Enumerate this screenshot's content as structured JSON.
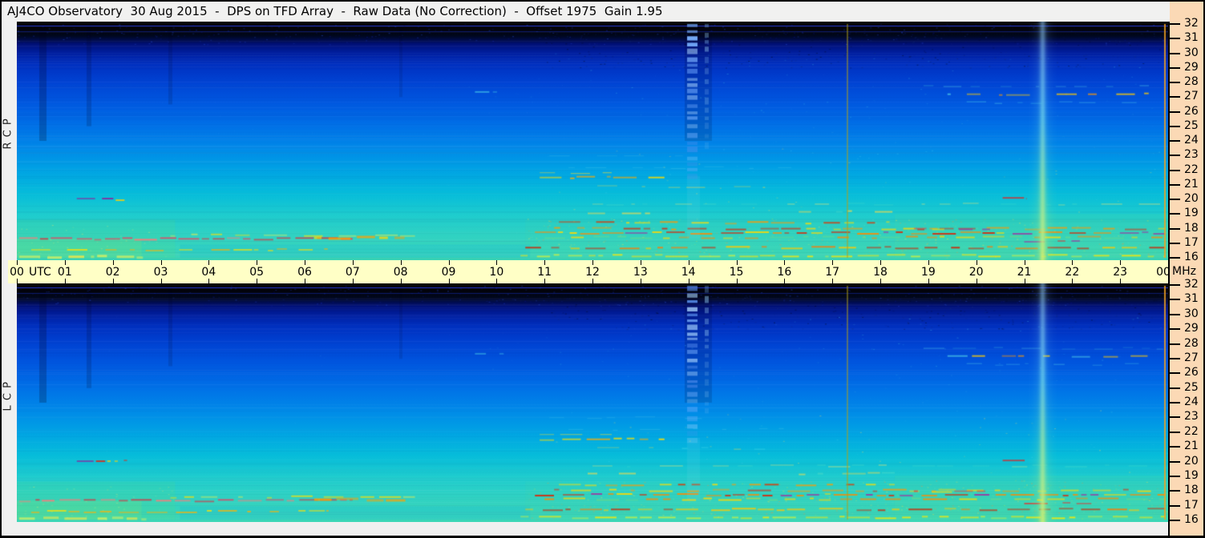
{
  "colors": {
    "titlebar_bg": "#f1f1f0",
    "time_band_bg": "#ffffc6",
    "freq_band_bg": "#fbd9b5",
    "gutter_bg": "#f0f0f0",
    "border": "#000000"
  },
  "chart_data": {
    "type": "heatmap",
    "title": "AJ4CO Observatory  30 Aug 2015  -  DPS on TFD Array  -  Raw Data (No Correction)  -  Offset 1975  Gain 1.95",
    "panels": [
      {
        "id": "rcp",
        "label": "R C P",
        "seed": 7
      },
      {
        "id": "lcp",
        "label": "L C P",
        "seed": 13
      }
    ],
    "x_axis": {
      "unit": "UTC",
      "right_unit": "MHz",
      "range_hours": [
        0,
        24
      ],
      "tick_labels": [
        "00",
        "01",
        "02",
        "03",
        "04",
        "05",
        "06",
        "07",
        "08",
        "09",
        "10",
        "11",
        "12",
        "13",
        "14",
        "15",
        "16",
        "17",
        "18",
        "19",
        "20",
        "21",
        "22",
        "23",
        "00"
      ]
    },
    "y_axis": {
      "unit": "MHz",
      "range_mhz": [
        16,
        32
      ],
      "ticks": [
        32,
        31,
        30,
        29,
        28,
        27,
        26,
        25,
        24,
        23,
        22,
        21,
        20,
        19,
        18,
        17,
        16
      ]
    },
    "gradient_stops": [
      [
        0.0,
        "#050505"
      ],
      [
        0.03,
        "#030308"
      ],
      [
        0.06,
        "#00071e"
      ],
      [
        0.095,
        "#001078"
      ],
      [
        0.13,
        "#001e9e"
      ],
      [
        0.18,
        "#0030c0"
      ],
      [
        0.25,
        "#0042d2"
      ],
      [
        0.33,
        "#0055de"
      ],
      [
        0.42,
        "#006ce6"
      ],
      [
        0.52,
        "#0086e8"
      ],
      [
        0.62,
        "#00a2e4"
      ],
      [
        0.72,
        "#06bcda"
      ],
      [
        0.81,
        "#1eccce"
      ],
      [
        0.9,
        "#30d2c2"
      ],
      [
        1.0,
        "#3cd6b6"
      ]
    ],
    "hlines": [
      {
        "y": 0.018,
        "c": "#2840ff",
        "a": 0.8
      },
      {
        "y": 0.041,
        "c": "#1830cc",
        "a": 0.5
      },
      {
        "y": 0.275,
        "c": "#ffffff",
        "a": 0.045
      },
      {
        "y": 0.52,
        "c": "#ffffff",
        "a": 0.06
      }
    ],
    "overlays": [
      {
        "t0": 0,
        "t1": 3.3,
        "f0": 16,
        "f1": 18.6,
        "c": "#58e07c",
        "a": 0.15
      },
      {
        "t0": 0,
        "t1": 2.6,
        "f0": 16,
        "f1": 17.3,
        "c": "#8ce86a",
        "a": 0.18
      },
      {
        "t0": 3.4,
        "t1": 10.7,
        "f0": 16,
        "f1": 16.9,
        "c": "#00a8e8",
        "a": 0.15
      },
      {
        "t0": 18.3,
        "t1": 24,
        "f0": 16,
        "f1": 19,
        "c": "#70e070",
        "a": 0.08
      },
      {
        "t0": 10.6,
        "t1": 24,
        "f0": 16,
        "f1": 18.6,
        "c": "#50dca0",
        "a": 0.1
      }
    ],
    "dark_columns": [
      {
        "t": 0.55,
        "w": 9,
        "f0": 24,
        "f1": 32,
        "c": "#000018",
        "a": 0.22
      },
      {
        "t": 1.5,
        "w": 6,
        "f0": 25,
        "f1": 32,
        "c": "#000018",
        "a": 0.16
      },
      {
        "t": 3.2,
        "w": 5,
        "f0": 26.5,
        "f1": 32,
        "c": "#000018",
        "a": 0.13
      },
      {
        "t": 8.0,
        "w": 4,
        "f0": 27,
        "f1": 32,
        "c": "#000010",
        "a": 0.1
      },
      {
        "t": 14.2,
        "w": 34,
        "f0": 24,
        "f1": 32,
        "c": "#000020",
        "a": 0.15
      }
    ],
    "noise": [
      {
        "t0": 0,
        "t1": 24,
        "f0": 30.6,
        "f1": 32,
        "colors": [
          "#1830c0",
          "#2850e0",
          "#081090"
        ],
        "d": 0.9,
        "a": 0.5,
        "s": 2
      },
      {
        "t0": 11,
        "t1": 24,
        "f0": 29,
        "f1": 31.5,
        "colors": [
          "#000818",
          "#122a78"
        ],
        "d": 0.8,
        "a": 0.5,
        "s": 2
      },
      {
        "t0": 10.6,
        "t1": 24,
        "f0": 16,
        "f1": 18.7,
        "colors": [
          "#ffe040",
          "#a0e060",
          "#ff9030",
          "#58dcc0"
        ],
        "d": 0.9,
        "a": 0.45,
        "s": 2
      },
      {
        "t0": 0,
        "t1": 3.3,
        "f0": 16,
        "f1": 18.3,
        "colors": [
          "#c0f080",
          "#ffe860"
        ],
        "d": 0.5,
        "a": 0.4,
        "s": 2
      },
      {
        "t0": 11,
        "t1": 24,
        "f0": 19,
        "f1": 23.5,
        "colors": [
          "#40c8e8",
          "#ffe060"
        ],
        "d": 0.1,
        "a": 0.4,
        "s": 2
      },
      {
        "t0": 11,
        "t1": 24,
        "f0": 25.5,
        "f1": 30,
        "colors": [
          "#2090e0",
          "#40c8e8"
        ],
        "d": 0.1,
        "a": 0.35,
        "s": 2
      },
      {
        "t0": 14,
        "t1": 24,
        "f0": 23,
        "f1": 26,
        "colors": [
          "#2f9fe0"
        ],
        "d": 0.08,
        "a": 0.3,
        "s": 2
      },
      {
        "t0": 5,
        "t1": 11,
        "f0": 26,
        "f1": 28.5,
        "colors": [
          "#30a0e0"
        ],
        "d": 0.03,
        "a": 0.3,
        "s": 2
      },
      {
        "t0": 0,
        "t1": 24,
        "f0": 16,
        "f1": 32,
        "colors": [
          "#ffffff"
        ],
        "d": 0.05,
        "a": 0.05,
        "s": 1
      }
    ],
    "streaks": [
      {
        "t0": 1.25,
        "t1": 2.3,
        "f": 20.05,
        "h": 2,
        "colors": [
          "#d03020",
          "#8030a0",
          "#ffd000"
        ],
        "d": 0.85,
        "a": 0.95
      },
      {
        "t0": 0.05,
        "t1": 7.0,
        "f": 17.35,
        "h": 2,
        "colors": [
          "#e84060",
          "#ff7878",
          "#d83040"
        ],
        "d": 0.9,
        "a": 0.9
      },
      {
        "t0": 0.3,
        "t1": 6.5,
        "f": 16.6,
        "h": 2,
        "colors": [
          "#ffe000",
          "#ffb000"
        ],
        "d": 0.5,
        "a": 0.8
      },
      {
        "t0": 3.2,
        "t1": 8.3,
        "f": 17.6,
        "h": 2,
        "colors": [
          "#ffe000",
          "#c8e860"
        ],
        "d": 0.35,
        "a": 0.7
      },
      {
        "t0": 0.05,
        "t1": 2.7,
        "f": 16.15,
        "h": 3,
        "colors": [
          "#d8f060",
          "#ffe840"
        ],
        "d": 0.75,
        "a": 0.8
      },
      {
        "t0": 6.2,
        "t1": 8.1,
        "f": 17.45,
        "h": 3,
        "colors": [
          "#ffd800",
          "#ffa000"
        ],
        "d": 0.7,
        "a": 0.85
      },
      {
        "t0": 10.8,
        "t1": 23.95,
        "f": 17.75,
        "h": 2,
        "colors": [
          "#ffd800",
          "#ff8800",
          "#e02000",
          "#a030a0"
        ],
        "d": 0.8,
        "a": 0.9
      },
      {
        "t0": 11.0,
        "t1": 23.95,
        "f": 17.45,
        "h": 2,
        "colors": [
          "#ffd800",
          "#ff8800",
          "#60d890"
        ],
        "d": 0.65,
        "a": 0.85
      },
      {
        "t0": 11.2,
        "t1": 23.95,
        "f": 18.05,
        "h": 2,
        "colors": [
          "#ffd800",
          "#e02000",
          "#ff9800"
        ],
        "d": 0.5,
        "a": 0.8
      },
      {
        "t0": 10.6,
        "t1": 23.95,
        "f": 16.75,
        "h": 2,
        "colors": [
          "#ffc800",
          "#ff7800",
          "#d02000"
        ],
        "d": 0.65,
        "a": 0.85
      },
      {
        "t0": 10.5,
        "t1": 23.95,
        "f": 16.2,
        "h": 2,
        "colors": [
          "#c8ee44",
          "#ffe800"
        ],
        "d": 0.7,
        "a": 0.8
      },
      {
        "t0": 11.3,
        "t1": 18.3,
        "f": 18.45,
        "h": 2,
        "colors": [
          "#ffdd00",
          "#ff9900",
          "#dd3300"
        ],
        "d": 0.55,
        "a": 0.8
      },
      {
        "t0": 10.9,
        "t1": 13.5,
        "f": 21.55,
        "h": 2,
        "colors": [
          "#ffdd00",
          "#ffaa00"
        ],
        "d": 0.7,
        "a": 0.85
      },
      {
        "t0": 10.9,
        "t1": 12.4,
        "f": 21.85,
        "h": 1,
        "colors": [
          "#ffdd22"
        ],
        "d": 0.5,
        "a": 0.7
      },
      {
        "t0": 12.0,
        "t1": 23.9,
        "f": 19.7,
        "h": 1,
        "colors": [
          "#48d8c8",
          "#ffe866"
        ],
        "d": 0.2,
        "a": 0.6
      },
      {
        "t0": 11.9,
        "t1": 13.2,
        "f": 19.15,
        "h": 2,
        "colors": [
          "#ffdd44"
        ],
        "d": 0.45,
        "a": 0.7
      },
      {
        "t0": 16.3,
        "t1": 18.3,
        "f": 19.2,
        "h": 2,
        "colors": [
          "#ffdd44",
          "#48d8c8"
        ],
        "d": 0.35,
        "a": 0.65
      },
      {
        "t0": 20.55,
        "t1": 21.05,
        "f": 20.1,
        "h": 2,
        "colors": [
          "#e02020"
        ],
        "d": 0.9,
        "a": 0.9
      },
      {
        "t0": 18.7,
        "t1": 20.5,
        "f": 18.0,
        "h": 2,
        "colors": [
          "#a030a0",
          "#e04040",
          "#ffdd00"
        ],
        "d": 0.6,
        "a": 0.8
      },
      {
        "t0": 19.4,
        "t1": 23.7,
        "f": 27.25,
        "h": 2,
        "colors": [
          "#ffcc00",
          "#ff9900",
          "#50d0e8"
        ],
        "d": 0.3,
        "a": 0.75
      },
      {
        "t0": 18.9,
        "t1": 23.9,
        "f": 27.75,
        "h": 1,
        "colors": [
          "#50c8e8",
          "#2898d8"
        ],
        "d": 0.25,
        "a": 0.6
      },
      {
        "t0": 19.8,
        "t1": 23.95,
        "f": 26.65,
        "h": 1,
        "colors": [
          "#30a8e8",
          "#50d0e8"
        ],
        "d": 0.25,
        "a": 0.55
      },
      {
        "t0": 11.5,
        "t1": 16.2,
        "f": 22.2,
        "h": 1,
        "colors": [
          "#40c0e8"
        ],
        "d": 0.15,
        "a": 0.5
      },
      {
        "t0": 12.1,
        "t1": 15.6,
        "f": 20.9,
        "h": 1,
        "colors": [
          "#ffdd44",
          "#48d8e8"
        ],
        "d": 0.2,
        "a": 0.6
      },
      {
        "t0": 21.0,
        "t1": 22.4,
        "f": 17.15,
        "h": 2,
        "colors": [
          "#a030a0",
          "#e03030"
        ],
        "d": 0.6,
        "a": 0.8
      },
      {
        "t0": 9.55,
        "t1": 10.4,
        "f": 27.35,
        "h": 2,
        "colors": [
          "#48d0e8"
        ],
        "d": 0.3,
        "a": 0.6
      },
      {
        "t0": 11.1,
        "t1": 14.3,
        "f": 23.0,
        "h": 1,
        "colors": [
          "#40c0e8"
        ],
        "d": 0.12,
        "a": 0.45
      }
    ],
    "vlines": [
      {
        "t": 17.32,
        "w": 2,
        "f0": 16,
        "f1": 32,
        "c": "#b0a018",
        "a": 0.5
      },
      {
        "t": 23.93,
        "w": 2,
        "f0": 16,
        "f1": 32,
        "c": "#f0a020",
        "a": 0.85
      },
      {
        "t": 14.1,
        "w": 16,
        "f0": 17.3,
        "f1": 21.6,
        "c": "#9adce8",
        "a": 0.1
      }
    ],
    "dashed_columns": [
      {
        "t": 14.08,
        "w": 13,
        "f0": 21.3,
        "f1": 32,
        "colors": [
          "#78b0ff",
          "#a8d4ff",
          "#5890f0"
        ],
        "dash": [
          3,
          7
        ],
        "gap": [
          2,
          6
        ],
        "a0": 0.95,
        "a1": 0.25
      },
      {
        "t": 14.38,
        "w": 5,
        "f0": 23.5,
        "f1": 32,
        "colors": [
          "#6fa8e8",
          "#90c8f0"
        ],
        "dash": [
          4,
          9
        ],
        "gap": [
          3,
          7
        ],
        "a0": 0.5,
        "a1": 0.15
      }
    ],
    "beams": [
      {
        "t": 21.37,
        "sigma": 7,
        "halo": 24,
        "a": 0.28,
        "stops": [
          [
            0,
            "rgba(120,180,248,0.55)"
          ],
          [
            0.4,
            "rgba(110,220,230,0.7)"
          ],
          [
            0.65,
            "rgba(150,230,170,0.8)"
          ],
          [
            1,
            "rgba(205,235,100,0.95)"
          ]
        ]
      },
      {
        "t": 21.37,
        "sigma": 2.6,
        "halo": 10,
        "a": 0.75,
        "stops": [
          [
            0,
            "rgba(150,205,250,0.6)"
          ],
          [
            0.4,
            "rgba(130,230,235,0.75)"
          ],
          [
            0.65,
            "rgba(170,235,160,0.85)"
          ],
          [
            1,
            "rgba(215,240,110,1)"
          ]
        ]
      }
    ]
  }
}
